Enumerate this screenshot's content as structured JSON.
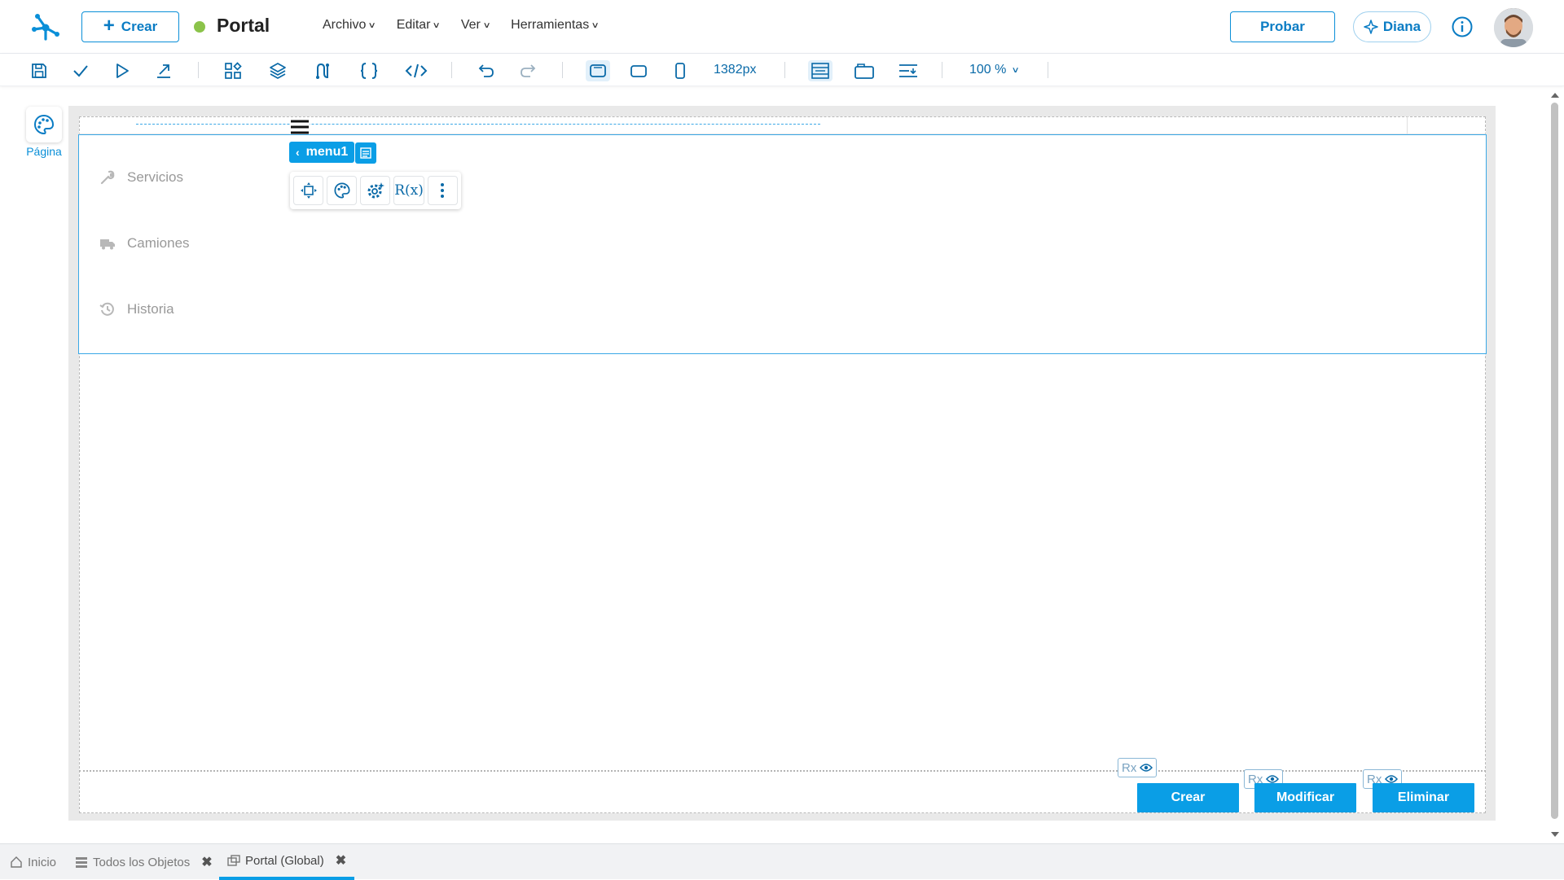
{
  "topbar": {
    "logo_icon": "app-logo-icon",
    "create_label": "Crear",
    "status_color": "#8bc34a",
    "title": "Portal",
    "menus": [
      "Archivo",
      "Editar",
      "Ver",
      "Herramientas"
    ],
    "test_label": "Probar",
    "assistant_label": "Diana",
    "info_icon": "info-icon",
    "avatar_icon": "user-avatar"
  },
  "toolbar": {
    "width_readout": "1382px",
    "zoom": "100 %",
    "icons": [
      "save-icon",
      "check-icon",
      "play-icon",
      "export-icon",
      "components-icon",
      "layers-icon",
      "flow-icon",
      "braces-icon",
      "code-icon",
      "undo-icon",
      "redo-icon",
      "desktop-icon",
      "tablet-icon",
      "mobile-icon",
      "layout-icon",
      "container-icon",
      "align-icon"
    ]
  },
  "left_rail": {
    "page_label": "Página"
  },
  "canvas": {
    "selected_component": "menu1",
    "menu_items": [
      {
        "label": "Servicios",
        "icon": "wrench-icon"
      },
      {
        "label": "Camiones",
        "icon": "truck-icon"
      },
      {
        "label": "Historia",
        "icon": "history-icon"
      }
    ],
    "floating_tools": [
      "move-icon",
      "palette-icon",
      "settings-icon",
      "rx-icon",
      "more-vertical-icon"
    ],
    "rx_label": "R(x)",
    "rx_badge_label": "Rx",
    "actions": [
      "Crear",
      "Modificar",
      "Eliminar"
    ]
  },
  "bottom_tabs": [
    {
      "label": "Inicio",
      "closable": false
    },
    {
      "label": "Todos los Objetos",
      "closable": true
    },
    {
      "label": "Portal (Global)",
      "closable": true,
      "active": true
    }
  ],
  "colors": {
    "accent": "#0a9ee6",
    "accent_dark": "#0a7cc4",
    "selection_border": "#3aa8e6"
  }
}
